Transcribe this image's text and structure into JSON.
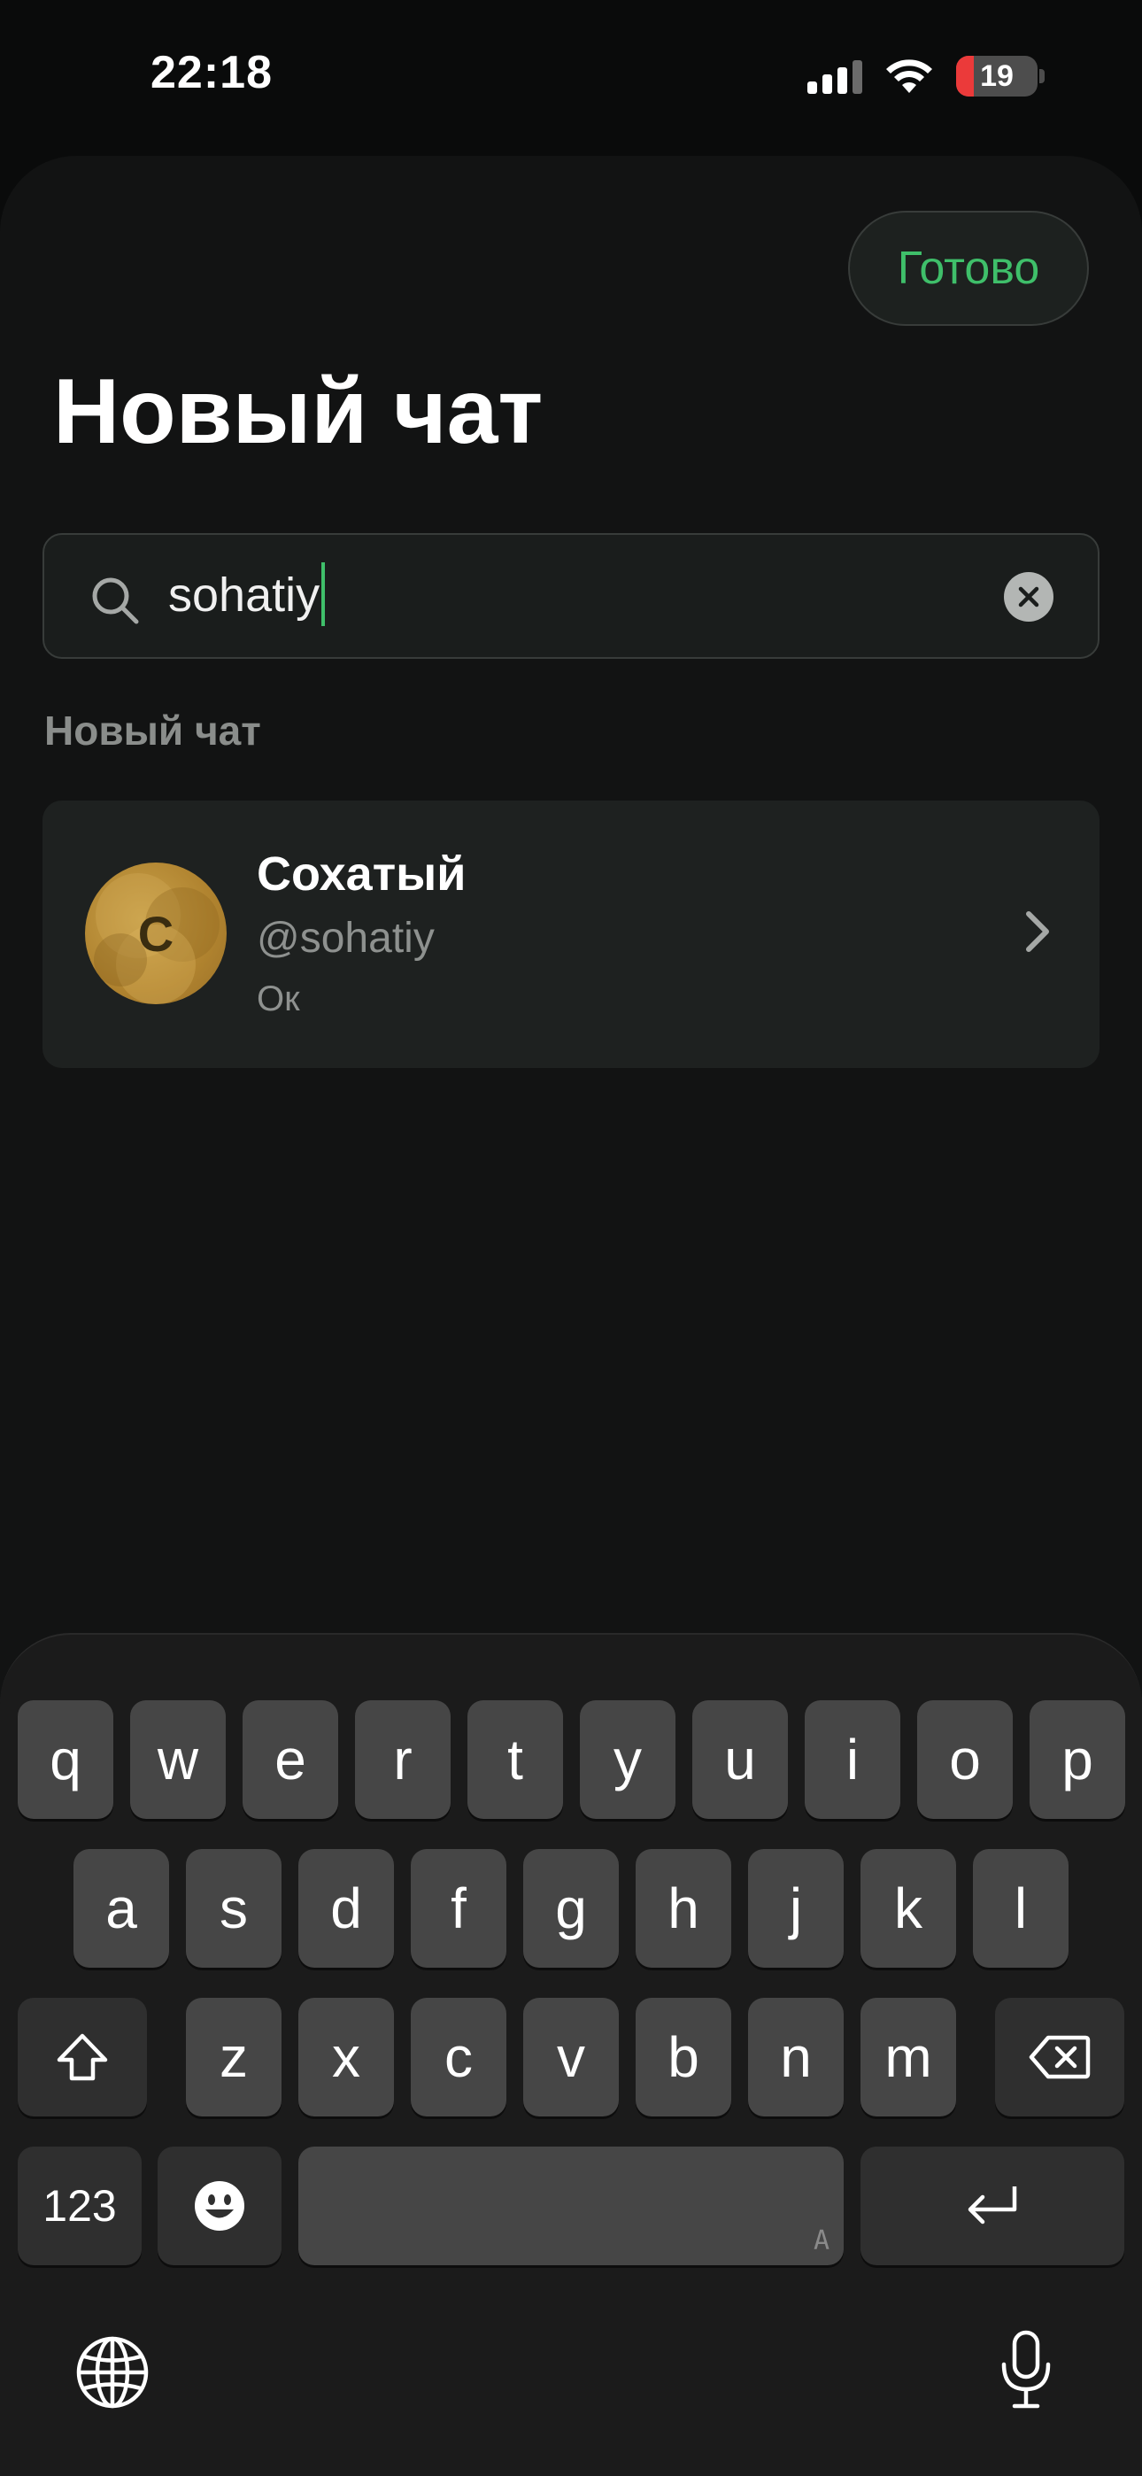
{
  "status_bar": {
    "time": "22:18",
    "battery_percent": "19"
  },
  "sheet": {
    "done_label": "Готово",
    "title": "Новый чат",
    "search": {
      "value": "sohatiy",
      "icon": "search-icon",
      "clear_icon": "clear-icon"
    },
    "section_label": "Новый чат",
    "contact": {
      "avatar_letter": "С",
      "name": "Сохатый",
      "handle": "@sohatiy",
      "status": "Ок"
    }
  },
  "keyboard": {
    "row1": [
      "q",
      "w",
      "e",
      "r",
      "t",
      "y",
      "u",
      "i",
      "o",
      "p"
    ],
    "row2": [
      "a",
      "s",
      "d",
      "f",
      "g",
      "h",
      "j",
      "k",
      "l"
    ],
    "row3": [
      "z",
      "x",
      "c",
      "v",
      "b",
      "n",
      "m"
    ],
    "numbers_label": "123",
    "space_mark": "A"
  },
  "colors": {
    "accent": "#3fbf6a",
    "background": "#121313",
    "key": "#464646",
    "battery_low": "#eb3a3a"
  }
}
